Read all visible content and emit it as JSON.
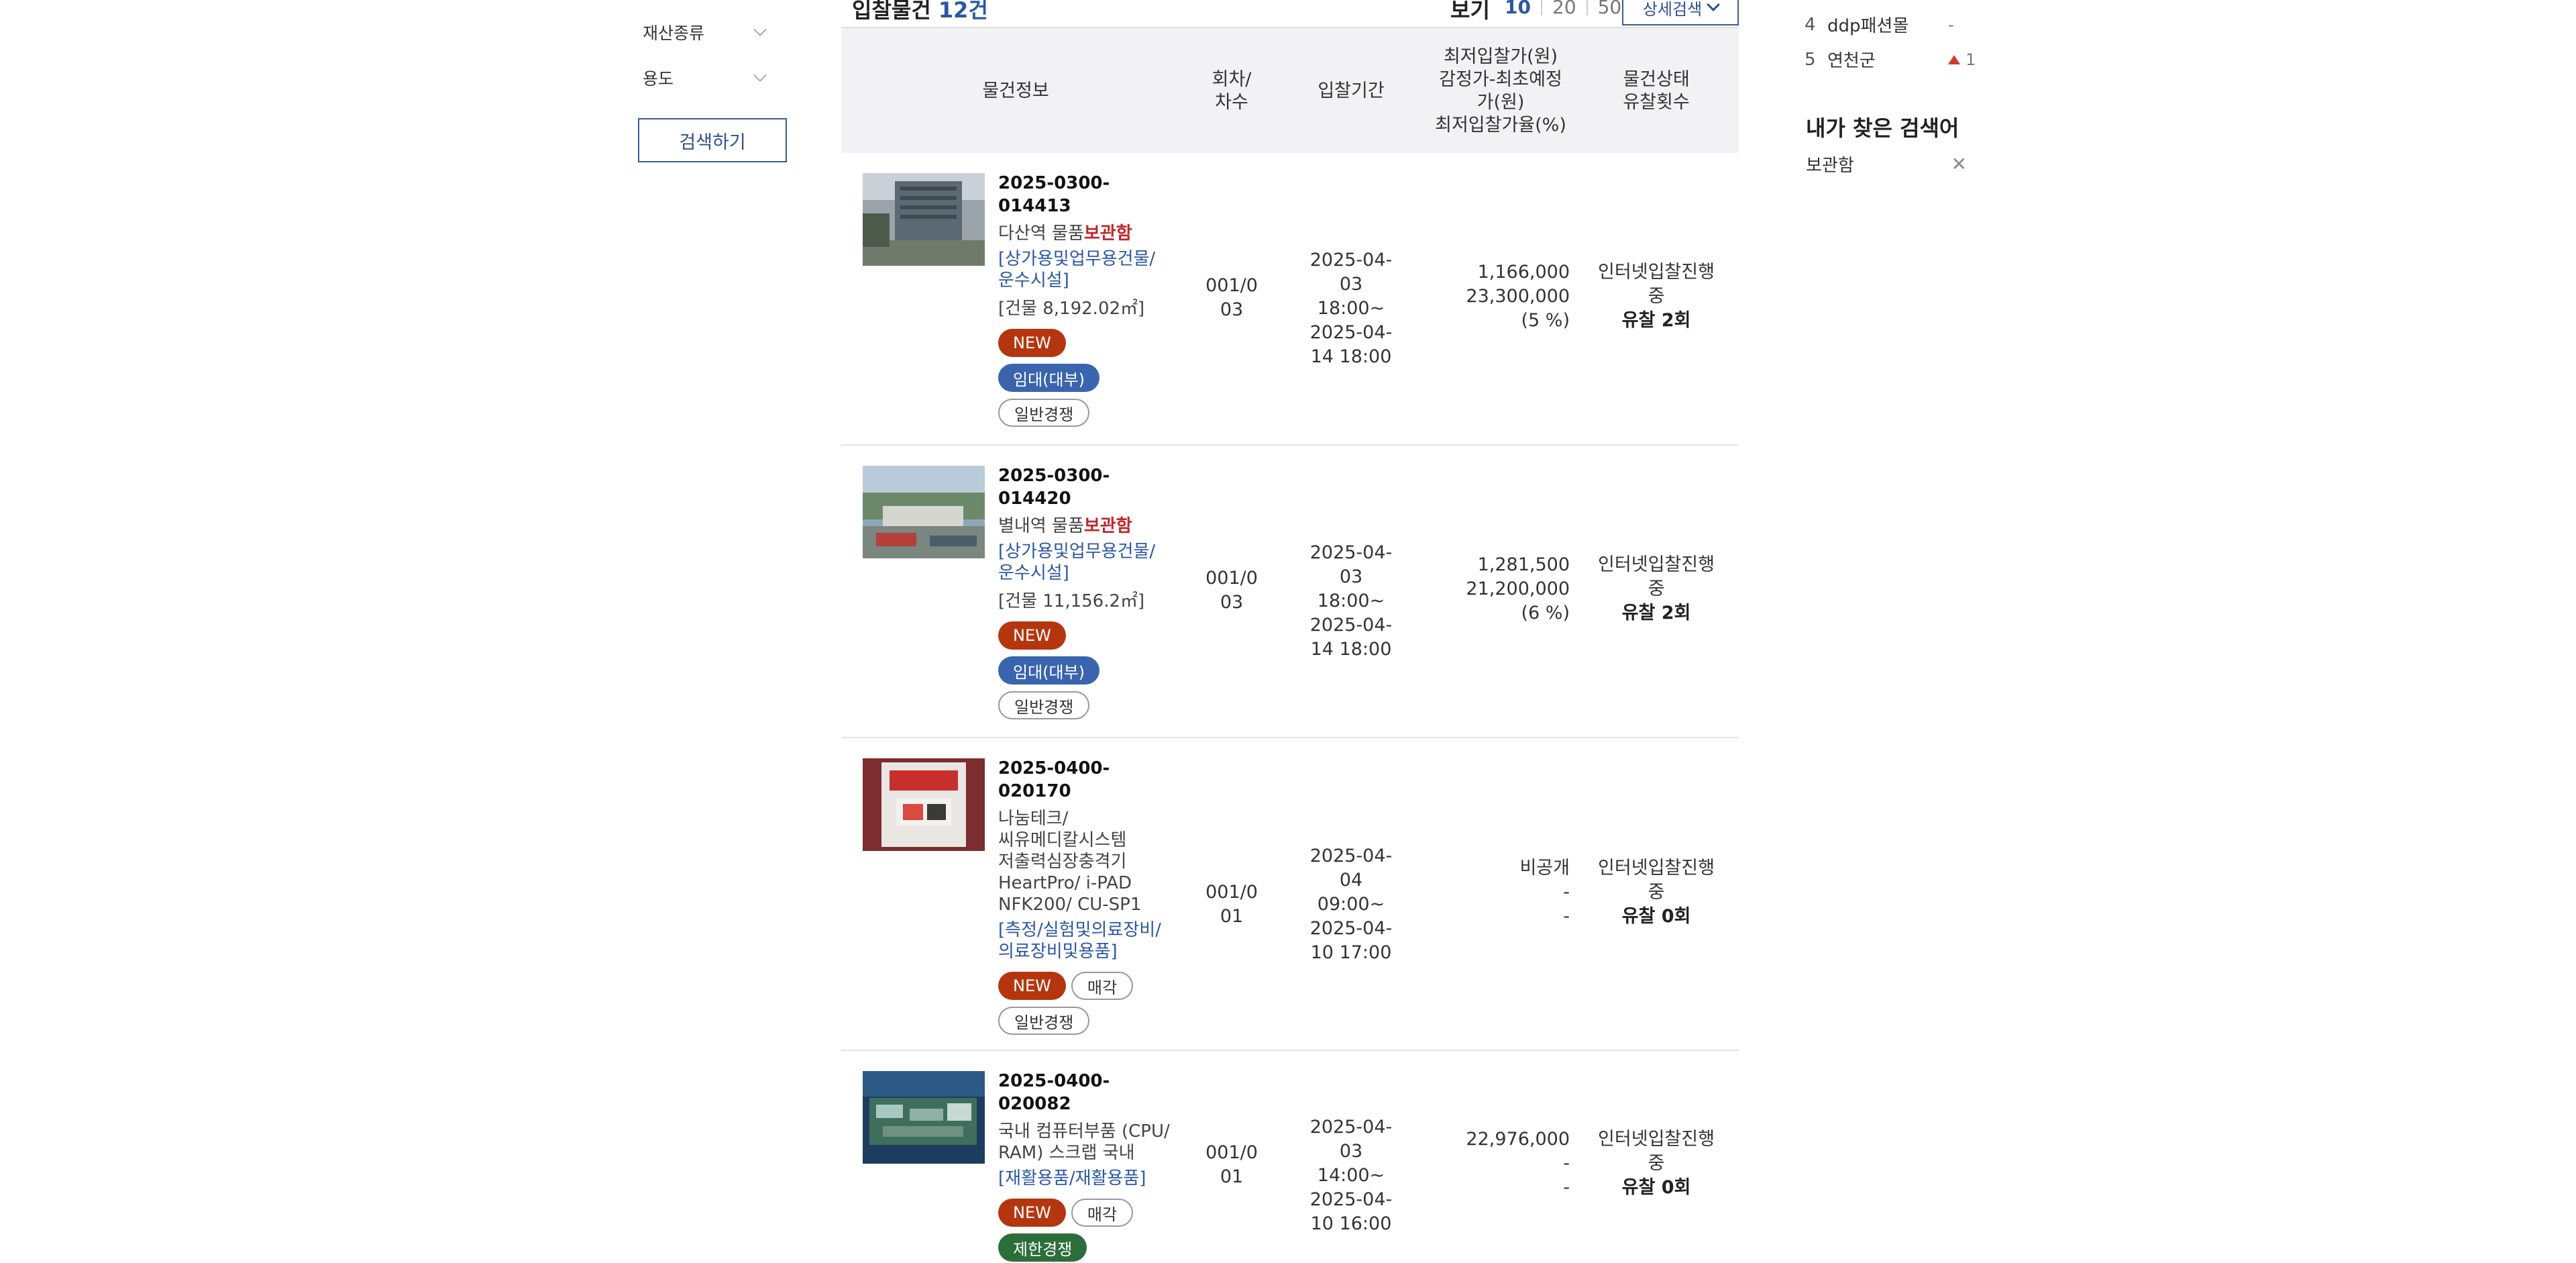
{
  "filters": {
    "property_type": "재산종류",
    "usage": "용도",
    "search_button": "검색하기"
  },
  "list_header": {
    "title": "입찰물건",
    "count": "12건",
    "view_label": "보기",
    "page_sizes": [
      "10",
      "20",
      "50"
    ],
    "selected_page_size": "10",
    "detail_search": "상세검색"
  },
  "table_headers": {
    "info": "물건정보",
    "round": [
      "회차/",
      "차수"
    ],
    "period": "입찰기간",
    "price": [
      "최저입찰가(원)",
      "감정가-최초예정",
      "가(원)",
      "최저입찰가율(%)"
    ],
    "status": [
      "물건상태",
      "유찰횟수"
    ]
  },
  "rows": [
    {
      "id": "2025-0300-014413",
      "name_prefix": "다산역 물품",
      "name_highlight": "보관함",
      "category": [
        "[상가용및업무용건물/",
        "운수시설]"
      ],
      "area": "[건물 8,192.02㎡]",
      "badges": [
        {
          "label": "NEW",
          "type": "new"
        },
        {
          "label": "임대(대부)",
          "type": "lease"
        },
        {
          "label": "일반경쟁",
          "type": "general"
        }
      ],
      "round": [
        "001/0",
        "03"
      ],
      "period": [
        "2025-04-",
        "03 18:00~",
        "2025-04-",
        "14 18:00"
      ],
      "price": [
        "1,166,000",
        "23,300,000",
        "(5 %)"
      ],
      "status": [
        "인터넷입찰진행",
        "중"
      ],
      "fail_count": "유찰 2회"
    },
    {
      "id": "2025-0300-014420",
      "name_prefix": "별내역 물품",
      "name_highlight": "보관함",
      "category": [
        "[상가용및업무용건물/",
        "운수시설]"
      ],
      "area": "[건물 11,156.2㎡]",
      "badges": [
        {
          "label": "NEW",
          "type": "new"
        },
        {
          "label": "임대(대부)",
          "type": "lease"
        },
        {
          "label": "일반경쟁",
          "type": "general"
        }
      ],
      "round": [
        "001/0",
        "03"
      ],
      "period": [
        "2025-04-",
        "03 18:00~",
        "2025-04-",
        "14 18:00"
      ],
      "price": [
        "1,281,500",
        "21,200,000",
        "(6 %)"
      ],
      "status": [
        "인터넷입찰진행",
        "중"
      ],
      "fail_count": "유찰 2회"
    },
    {
      "id": "2025-0400-020170",
      "name_lines": [
        "나눔테크/",
        "씨유메디칼시스템",
        "저출력심장충격기",
        "HeartPro/ i-PAD",
        "NFK200/ CU-SP1"
      ],
      "category": [
        "[측정/실험및의료장비/",
        "의료장비및용품]"
      ],
      "badges": [
        {
          "label": "NEW",
          "type": "new"
        },
        {
          "label": "매각",
          "type": "sell"
        },
        {
          "label": "일반경쟁",
          "type": "general"
        }
      ],
      "round": [
        "001/0",
        "01"
      ],
      "period": [
        "2025-04-",
        "04 09:00~",
        "2025-04-",
        "10 17:00"
      ],
      "price": [
        "비공개",
        "-",
        "-"
      ],
      "status": [
        "인터넷입찰진행",
        "중"
      ],
      "fail_count": "유찰 0회"
    },
    {
      "id": "2025-0400-020082",
      "name_lines": [
        "국내 컴퓨터부품 (CPU/",
        "RAM) 스크랩 국내"
      ],
      "category": [
        "[재활용품/재활용품]"
      ],
      "badges": [
        {
          "label": "NEW",
          "type": "new"
        },
        {
          "label": "매각",
          "type": "sell"
        },
        {
          "label": "제한경쟁",
          "type": "limited"
        }
      ],
      "round": [
        "001/0",
        "01"
      ],
      "period": [
        "2025-04-",
        "03 14:00~",
        "2025-04-",
        "10 16:00"
      ],
      "price": [
        "22,976,000",
        "-",
        "-"
      ],
      "status": [
        "인터넷입찰진행",
        "중"
      ],
      "fail_count": "유찰 0회"
    }
  ],
  "popular_keywords": [
    {
      "rank": "4",
      "word": "ddp패션몰",
      "change": "-",
      "up": false
    },
    {
      "rank": "5",
      "word": "연천군",
      "change": "1",
      "up": true
    }
  ],
  "recent_searches": {
    "title": "내가 찾은 검색어",
    "items": [
      {
        "word": "보관함",
        "remove": "✕"
      }
    ]
  },
  "colors": {
    "accent_blue": "#2b57a3",
    "new_badge": "#b5360e",
    "lease_badge": "#3a64ae",
    "limited_badge": "#2c6e3a",
    "highlight_red": "#c0272d"
  }
}
